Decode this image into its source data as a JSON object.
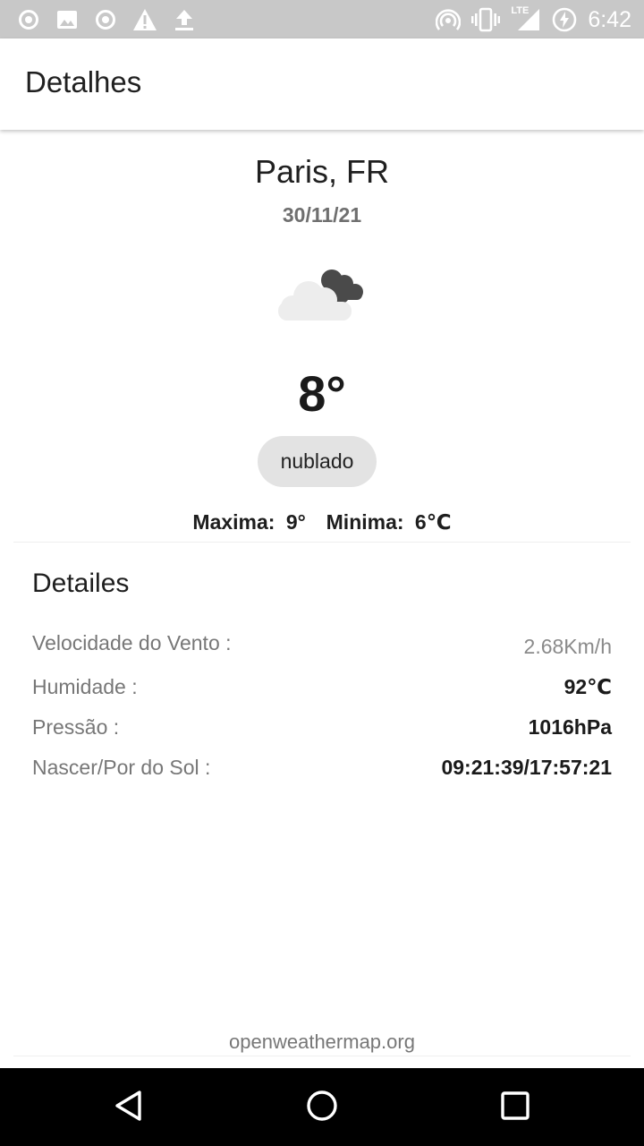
{
  "status_bar": {
    "time": "6:42",
    "network": "LTE",
    "icons_left": [
      "record-icon",
      "image-icon",
      "record-icon",
      "warning-icon",
      "upload-icon"
    ],
    "icons_right": [
      "hotspot-icon",
      "vibrate-icon",
      "signal-icon",
      "battery-charging-icon"
    ]
  },
  "app_bar": {
    "title": "Detalhes"
  },
  "weather": {
    "city": "Paris, FR",
    "date": "30/11/21",
    "icon": "cloudy-night-icon",
    "temperature": "8°",
    "condition": "nublado",
    "max_label": "Maxima:",
    "max_value": "9°",
    "min_label": "Minima:",
    "min_value": "6℃"
  },
  "details": {
    "title": "Detailes",
    "rows": [
      {
        "label": "Velocidade do Vento :",
        "value": "2.68Km/h"
      },
      {
        "label": "Humidade :",
        "value": "92℃"
      },
      {
        "label": "Pressão :",
        "value": "1016hPa"
      },
      {
        "label": "Nascer/Por do Sol :",
        "value": "09:21:39/17:57:21"
      }
    ]
  },
  "footer": {
    "link": "openweathermap.org"
  },
  "nav_bar": {
    "buttons": [
      "back-icon",
      "home-icon",
      "recents-icon"
    ]
  },
  "colors": {
    "status_bar": "#c8c8c8",
    "chip_bg": "#e3e3e3",
    "nav_bar": "#000000"
  }
}
